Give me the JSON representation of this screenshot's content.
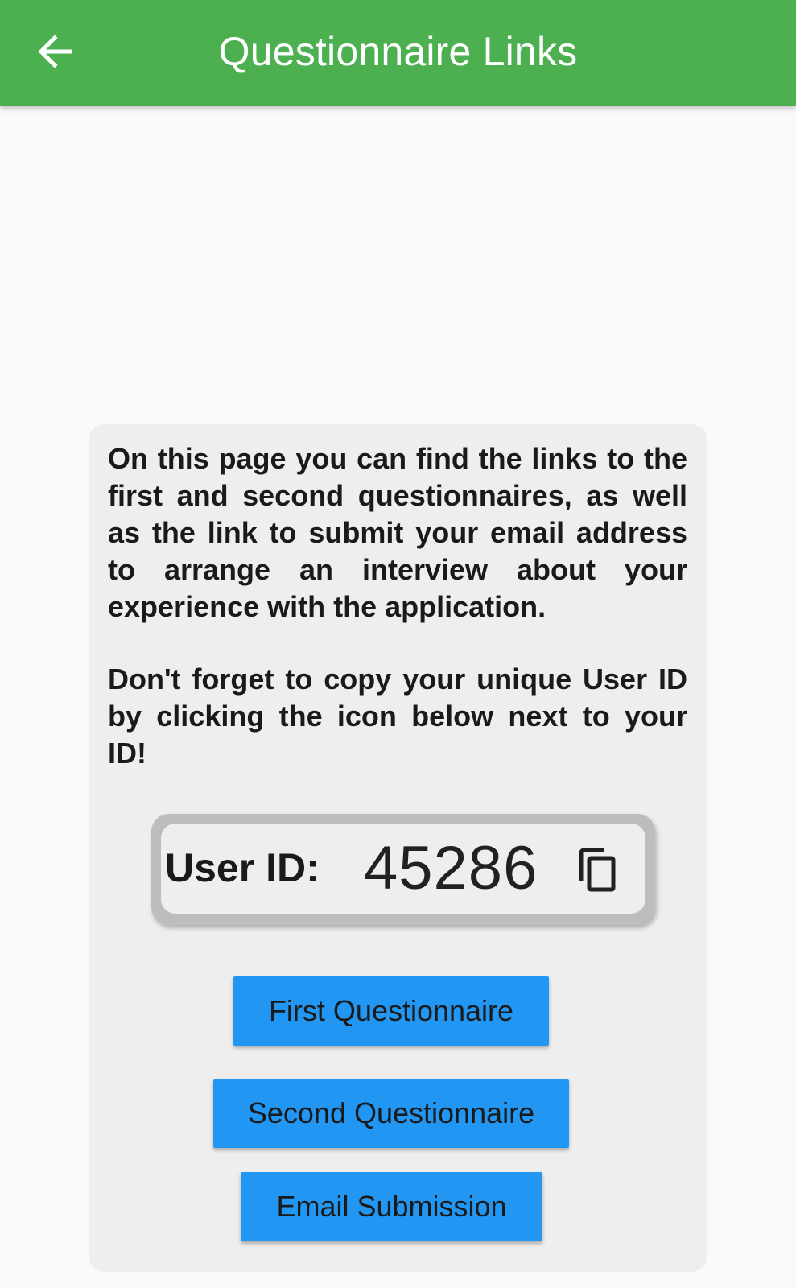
{
  "app_bar": {
    "title": "Questionnaire Links",
    "back_icon": "arrow-left-icon",
    "color": "#4caf50"
  },
  "card": {
    "paragraph_1": "On this page you can find the links to the first and second questionnaires, as well as the link to submit your email address to arrange an interview about your experience with the application.",
    "paragraph_2": "Don't forget to copy your unique User ID by clicking the icon below next to your ID!",
    "user_id": {
      "label": "User ID:",
      "value": "45286",
      "copy_icon": "copy-icon"
    },
    "buttons": {
      "first": "First Questionnaire",
      "second": "Second Questionnaire",
      "email": "Email Submission",
      "color": "#2196f3"
    }
  }
}
